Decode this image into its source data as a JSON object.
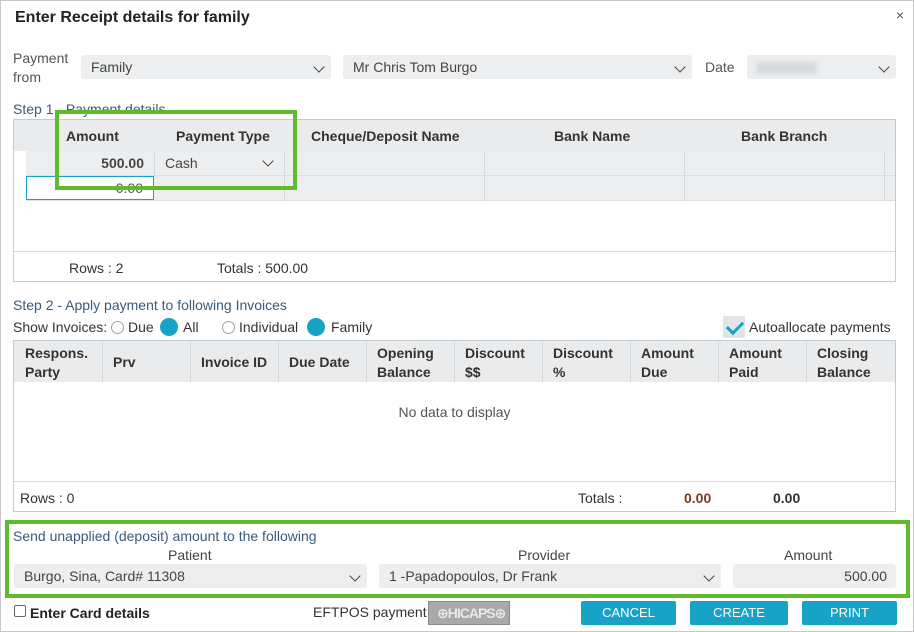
{
  "dialog": {
    "title": "Enter Receipt details for family",
    "close": "×"
  },
  "payment_from": {
    "label_line1": "Payment",
    "label_line2": "from",
    "type_value": "Family",
    "person_value": "Mr Chris Tom Burgo",
    "date_label": "Date"
  },
  "step1": {
    "title": "Step 1 - Payment details",
    "columns": [
      "Amount",
      "Payment Type",
      "Cheque/Deposit Name",
      "Bank Name",
      "Bank Branch"
    ],
    "rows": [
      {
        "amount": "500.00",
        "payment_type": "Cash"
      },
      {
        "amount": "0.00",
        "payment_type": ""
      }
    ],
    "rows_label": "Rows : 2",
    "totals_label": "Totals : 500.00"
  },
  "step2": {
    "title": "Step 2 - Apply payment to following Invoices",
    "show_invoices_label": "Show Invoices:",
    "options": {
      "due": "Due",
      "all": "All",
      "individual": "Individual",
      "family": "Family"
    },
    "autoallocate_label": "Autoallocate payments",
    "columns": [
      [
        "Respons.",
        "Party"
      ],
      [
        "Prv",
        ""
      ],
      [
        "Invoice ID",
        ""
      ],
      [
        "Due Date",
        ""
      ],
      [
        "Opening",
        "Balance"
      ],
      [
        "Discount",
        "$$"
      ],
      [
        "Discount",
        "%"
      ],
      [
        "Amount",
        "Due"
      ],
      [
        "Amount",
        "Paid"
      ],
      [
        "Closing",
        "Balance"
      ]
    ],
    "no_data": "No data to display",
    "rows_label": "Rows : 0",
    "totals_label": "Totals :",
    "total_due": "0.00",
    "total_paid": "0.00",
    "due_color": "#7a3b1e"
  },
  "deposit": {
    "title": "Send unapplied (deposit) amount to the following",
    "patient_label": "Patient",
    "patient_value": "Burgo, Sina, Card# 11308",
    "provider_label": "Provider",
    "provider_value": "1 -Papadopoulos, Dr Frank",
    "amount_label": "Amount",
    "amount_value": "500.00"
  },
  "footer": {
    "card_label": "Enter Card details",
    "eftpos_label": "EFTPOS payment",
    "cancel": "CANCEL",
    "create": "CREATE",
    "print": "PRINT"
  },
  "colors": {
    "accent": "#17a2c7",
    "highlight": "#5dbb2c"
  }
}
